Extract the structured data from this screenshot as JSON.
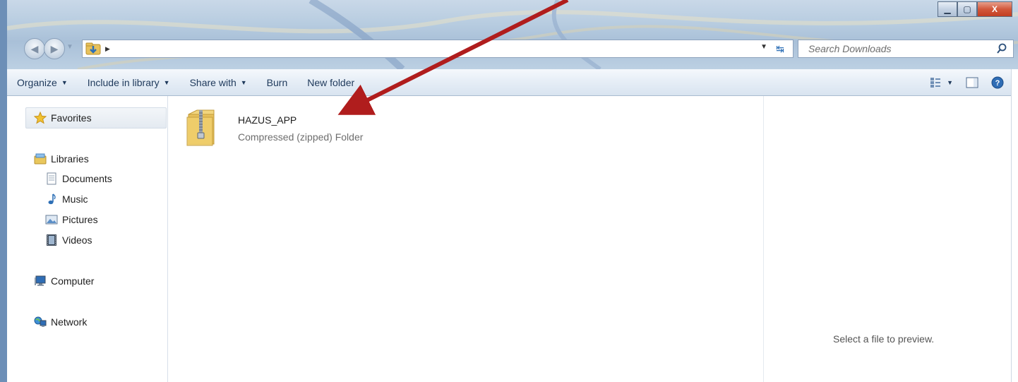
{
  "window": {
    "controls": {
      "minimize": "▁",
      "maximize": "▢",
      "close": "X"
    }
  },
  "address": {
    "path_text": "",
    "search_placeholder": "Search Downloads"
  },
  "toolbar": {
    "items": [
      {
        "label": "Organize",
        "has_dropdown": true
      },
      {
        "label": "Include in library",
        "has_dropdown": true
      },
      {
        "label": "Share with",
        "has_dropdown": true
      },
      {
        "label": "Burn",
        "has_dropdown": false
      },
      {
        "label": "New folder",
        "has_dropdown": false
      }
    ],
    "right_icons": [
      "view-options-icon",
      "preview-pane-icon",
      "help-icon"
    ]
  },
  "sidebar": {
    "favorites": {
      "label": "Favorites",
      "icon": "star-icon"
    },
    "libraries": {
      "label": "Libraries",
      "icon": "libraries-icon",
      "children": [
        {
          "label": "Documents",
          "icon": "documents-icon"
        },
        {
          "label": "Music",
          "icon": "music-icon"
        },
        {
          "label": "Pictures",
          "icon": "pictures-icon"
        },
        {
          "label": "Videos",
          "icon": "videos-icon"
        }
      ]
    },
    "computer": {
      "label": "Computer",
      "icon": "computer-icon"
    },
    "network": {
      "label": "Network",
      "icon": "network-icon"
    }
  },
  "files": [
    {
      "name": "HAZUS_APP",
      "type": "Compressed (zipped) Folder",
      "icon": "zip-folder-icon"
    }
  ],
  "preview": {
    "message": "Select a file to preview."
  },
  "colors": {
    "frame": "#6d8fb7",
    "toolbar_text": "#1e395b",
    "annotation_arrow": "#b01d1d",
    "close_button": "#c23e22"
  }
}
